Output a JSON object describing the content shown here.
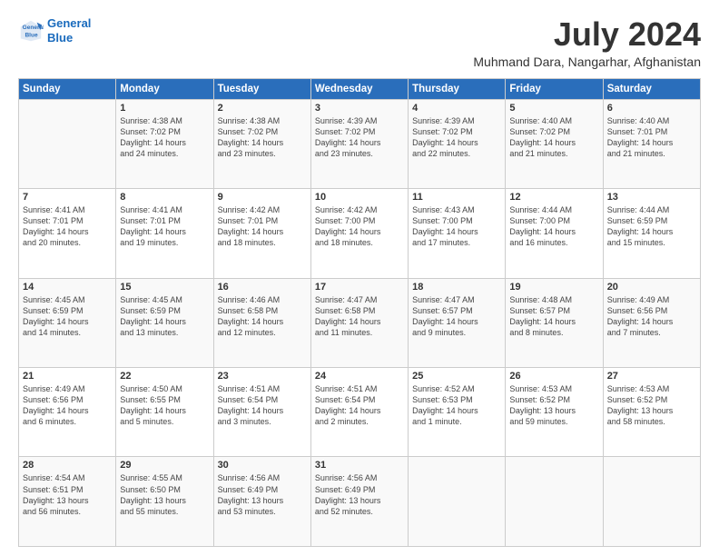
{
  "logo": {
    "line1": "General",
    "line2": "Blue"
  },
  "title": "July 2024",
  "subtitle": "Muhmand Dara, Nangarhar, Afghanistan",
  "days_of_week": [
    "Sunday",
    "Monday",
    "Tuesday",
    "Wednesday",
    "Thursday",
    "Friday",
    "Saturday"
  ],
  "weeks": [
    [
      {
        "day": "",
        "sunrise": "",
        "sunset": "",
        "daylight": ""
      },
      {
        "day": "1",
        "sunrise": "Sunrise: 4:38 AM",
        "sunset": "Sunset: 7:02 PM",
        "daylight": "Daylight: 14 hours and 24 minutes."
      },
      {
        "day": "2",
        "sunrise": "Sunrise: 4:38 AM",
        "sunset": "Sunset: 7:02 PM",
        "daylight": "Daylight: 14 hours and 23 minutes."
      },
      {
        "day": "3",
        "sunrise": "Sunrise: 4:39 AM",
        "sunset": "Sunset: 7:02 PM",
        "daylight": "Daylight: 14 hours and 23 minutes."
      },
      {
        "day": "4",
        "sunrise": "Sunrise: 4:39 AM",
        "sunset": "Sunset: 7:02 PM",
        "daylight": "Daylight: 14 hours and 22 minutes."
      },
      {
        "day": "5",
        "sunrise": "Sunrise: 4:40 AM",
        "sunset": "Sunset: 7:02 PM",
        "daylight": "Daylight: 14 hours and 21 minutes."
      },
      {
        "day": "6",
        "sunrise": "Sunrise: 4:40 AM",
        "sunset": "Sunset: 7:01 PM",
        "daylight": "Daylight: 14 hours and 21 minutes."
      }
    ],
    [
      {
        "day": "7",
        "sunrise": "Sunrise: 4:41 AM",
        "sunset": "Sunset: 7:01 PM",
        "daylight": "Daylight: 14 hours and 20 minutes."
      },
      {
        "day": "8",
        "sunrise": "Sunrise: 4:41 AM",
        "sunset": "Sunset: 7:01 PM",
        "daylight": "Daylight: 14 hours and 19 minutes."
      },
      {
        "day": "9",
        "sunrise": "Sunrise: 4:42 AM",
        "sunset": "Sunset: 7:01 PM",
        "daylight": "Daylight: 14 hours and 18 minutes."
      },
      {
        "day": "10",
        "sunrise": "Sunrise: 4:42 AM",
        "sunset": "Sunset: 7:00 PM",
        "daylight": "Daylight: 14 hours and 18 minutes."
      },
      {
        "day": "11",
        "sunrise": "Sunrise: 4:43 AM",
        "sunset": "Sunset: 7:00 PM",
        "daylight": "Daylight: 14 hours and 17 minutes."
      },
      {
        "day": "12",
        "sunrise": "Sunrise: 4:44 AM",
        "sunset": "Sunset: 7:00 PM",
        "daylight": "Daylight: 14 hours and 16 minutes."
      },
      {
        "day": "13",
        "sunrise": "Sunrise: 4:44 AM",
        "sunset": "Sunset: 6:59 PM",
        "daylight": "Daylight: 14 hours and 15 minutes."
      }
    ],
    [
      {
        "day": "14",
        "sunrise": "Sunrise: 4:45 AM",
        "sunset": "Sunset: 6:59 PM",
        "daylight": "Daylight: 14 hours and 14 minutes."
      },
      {
        "day": "15",
        "sunrise": "Sunrise: 4:45 AM",
        "sunset": "Sunset: 6:59 PM",
        "daylight": "Daylight: 14 hours and 13 minutes."
      },
      {
        "day": "16",
        "sunrise": "Sunrise: 4:46 AM",
        "sunset": "Sunset: 6:58 PM",
        "daylight": "Daylight: 14 hours and 12 minutes."
      },
      {
        "day": "17",
        "sunrise": "Sunrise: 4:47 AM",
        "sunset": "Sunset: 6:58 PM",
        "daylight": "Daylight: 14 hours and 11 minutes."
      },
      {
        "day": "18",
        "sunrise": "Sunrise: 4:47 AM",
        "sunset": "Sunset: 6:57 PM",
        "daylight": "Daylight: 14 hours and 9 minutes."
      },
      {
        "day": "19",
        "sunrise": "Sunrise: 4:48 AM",
        "sunset": "Sunset: 6:57 PM",
        "daylight": "Daylight: 14 hours and 8 minutes."
      },
      {
        "day": "20",
        "sunrise": "Sunrise: 4:49 AM",
        "sunset": "Sunset: 6:56 PM",
        "daylight": "Daylight: 14 hours and 7 minutes."
      }
    ],
    [
      {
        "day": "21",
        "sunrise": "Sunrise: 4:49 AM",
        "sunset": "Sunset: 6:56 PM",
        "daylight": "Daylight: 14 hours and 6 minutes."
      },
      {
        "day": "22",
        "sunrise": "Sunrise: 4:50 AM",
        "sunset": "Sunset: 6:55 PM",
        "daylight": "Daylight: 14 hours and 5 minutes."
      },
      {
        "day": "23",
        "sunrise": "Sunrise: 4:51 AM",
        "sunset": "Sunset: 6:54 PM",
        "daylight": "Daylight: 14 hours and 3 minutes."
      },
      {
        "day": "24",
        "sunrise": "Sunrise: 4:51 AM",
        "sunset": "Sunset: 6:54 PM",
        "daylight": "Daylight: 14 hours and 2 minutes."
      },
      {
        "day": "25",
        "sunrise": "Sunrise: 4:52 AM",
        "sunset": "Sunset: 6:53 PM",
        "daylight": "Daylight: 14 hours and 1 minute."
      },
      {
        "day": "26",
        "sunrise": "Sunrise: 4:53 AM",
        "sunset": "Sunset: 6:52 PM",
        "daylight": "Daylight: 13 hours and 59 minutes."
      },
      {
        "day": "27",
        "sunrise": "Sunrise: 4:53 AM",
        "sunset": "Sunset: 6:52 PM",
        "daylight": "Daylight: 13 hours and 58 minutes."
      }
    ],
    [
      {
        "day": "28",
        "sunrise": "Sunrise: 4:54 AM",
        "sunset": "Sunset: 6:51 PM",
        "daylight": "Daylight: 13 hours and 56 minutes."
      },
      {
        "day": "29",
        "sunrise": "Sunrise: 4:55 AM",
        "sunset": "Sunset: 6:50 PM",
        "daylight": "Daylight: 13 hours and 55 minutes."
      },
      {
        "day": "30",
        "sunrise": "Sunrise: 4:56 AM",
        "sunset": "Sunset: 6:49 PM",
        "daylight": "Daylight: 13 hours and 53 minutes."
      },
      {
        "day": "31",
        "sunrise": "Sunrise: 4:56 AM",
        "sunset": "Sunset: 6:49 PM",
        "daylight": "Daylight: 13 hours and 52 minutes."
      },
      {
        "day": "",
        "sunrise": "",
        "sunset": "",
        "daylight": ""
      },
      {
        "day": "",
        "sunrise": "",
        "sunset": "",
        "daylight": ""
      },
      {
        "day": "",
        "sunrise": "",
        "sunset": "",
        "daylight": ""
      }
    ]
  ]
}
